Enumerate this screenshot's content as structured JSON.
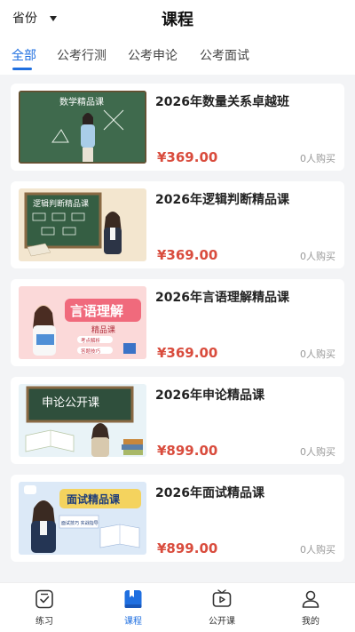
{
  "header": {
    "province": "省份",
    "title": "课程"
  },
  "tabs": [
    {
      "label": "全部"
    },
    {
      "label": "公考行测"
    },
    {
      "label": "公考申论"
    },
    {
      "label": "公考面试"
    }
  ],
  "courses": [
    {
      "title": "2026年数量关系卓越班",
      "price": "¥369.00",
      "buyers": "0人购买",
      "thumb_text": "数学精品课"
    },
    {
      "title": "2026年逻辑判断精品课",
      "price": "¥369.00",
      "buyers": "0人购买",
      "thumb_text": "逻辑判断精品课"
    },
    {
      "title": "2026年言语理解精品课",
      "price": "¥369.00",
      "buyers": "0人购买",
      "thumb_text": "言语理解",
      "thumb_subtext": "精品课",
      "thumb_tag1": "考点解析",
      "thumb_tag2": "答题技巧"
    },
    {
      "title": "2026年申论精品课",
      "price": "¥899.00",
      "buyers": "0人购买",
      "thumb_text": "申论公开课"
    },
    {
      "title": "2026年面试精品课",
      "price": "¥899.00",
      "buyers": "0人购买",
      "thumb_text": "面试精品课",
      "thumb_tag1": "面试技巧 实战指导"
    }
  ],
  "bottom_nav": [
    {
      "label": "练习",
      "icon": "practice-icon"
    },
    {
      "label": "课程",
      "icon": "course-icon"
    },
    {
      "label": "公开课",
      "icon": "tv-icon"
    },
    {
      "label": "我的",
      "icon": "profile-icon"
    }
  ],
  "colors": {
    "accent": "#1f6fe0",
    "price": "#d94c3d"
  }
}
